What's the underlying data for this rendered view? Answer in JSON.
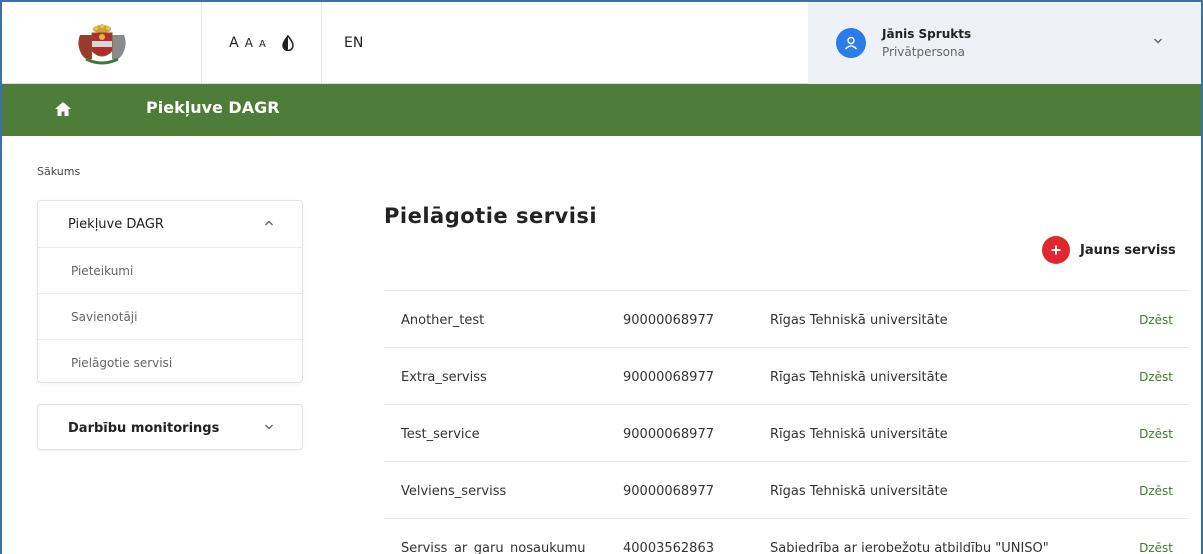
{
  "header": {
    "font_sizes": [
      "A",
      "A",
      "A"
    ],
    "language": "EN",
    "user": {
      "name": "Jānis Sprukts",
      "role": "Privātpersona"
    }
  },
  "nav": {
    "title": "Piekļuve DAGR"
  },
  "breadcrumb": "Sākums",
  "sidebar": {
    "section1": {
      "title": "Piekļuve DAGR",
      "items": [
        "Pieteikumi",
        "Savienotāji",
        "Pielāgotie servisi"
      ]
    },
    "section2": {
      "title": "Darbību monitorings"
    }
  },
  "main": {
    "title": "Pielāgotie servisi",
    "new_button": "Jauns serviss",
    "rows": [
      {
        "name": "Another_test",
        "code": "90000068977",
        "org": "Rīgas Tehniskā universitāte",
        "action": "Dzēst"
      },
      {
        "name": "Extra_serviss",
        "code": "90000068977",
        "org": "Rīgas Tehniskā universitāte",
        "action": "Dzēst"
      },
      {
        "name": "Test_service",
        "code": "90000068977",
        "org": "Rīgas Tehniskā universitāte",
        "action": "Dzēst"
      },
      {
        "name": "Velviens_serviss",
        "code": "90000068977",
        "org": "Rīgas Tehniskā universitāte",
        "action": "Dzēst"
      },
      {
        "name": "Serviss_ar_garu_nosaukumu",
        "code": "40003562863",
        "org": "Sabiedrība ar ierobežotu atbildību \"UNISO\"",
        "action": "Dzēst"
      }
    ]
  },
  "colors": {
    "green_bar": "#4e7d3a",
    "accent_blue": "#2b7de9",
    "plus_red": "#e0262f",
    "delete_green": "#3e7a2a"
  },
  "icons": {
    "logo": "coat-of-arms-icon",
    "contrast": "contrast-drop-icon",
    "user": "user-icon",
    "home": "home-icon",
    "plus": "plus-icon",
    "chevron_down": "chevron-down-icon",
    "chevron_up": "chevron-up-icon"
  }
}
